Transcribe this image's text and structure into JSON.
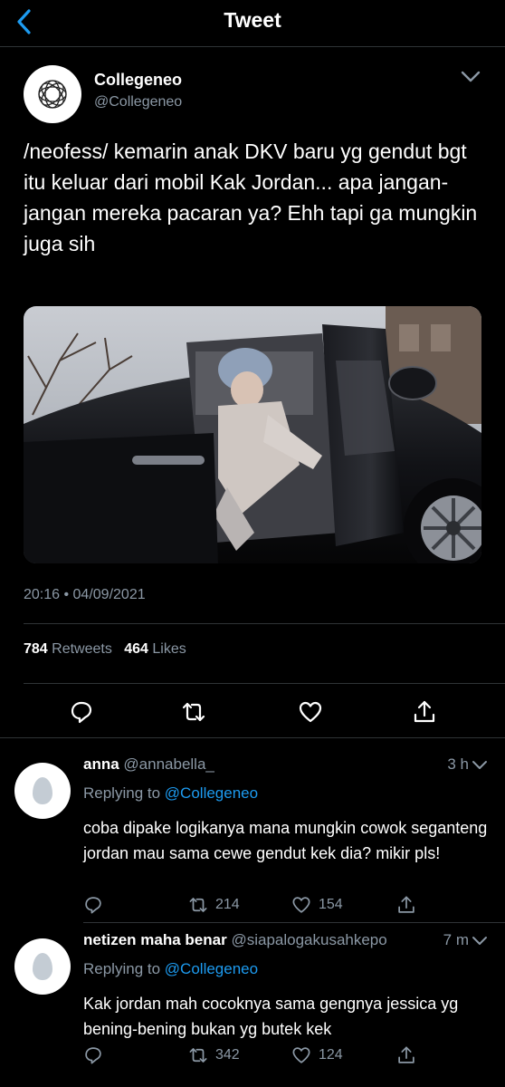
{
  "header": {
    "title": "Tweet"
  },
  "tweet": {
    "author_name": "Collegeneo",
    "author_handle": "@Collegeneo",
    "text": "/neofess/ kemarin anak DKV baru yg gendut bgt  itu keluar dari mobil Kak Jordan... apa jangan-jangan mereka pacaran ya? Ehh tapi ga mungkin juga sih",
    "timestamp": "20:16 • 04/09/2021",
    "retweets_count": "784",
    "retweets_label": "Retweets",
    "likes_count": "464",
    "likes_label": "Likes"
  },
  "replies": [
    {
      "name": "anna",
      "handle": "@annabella_",
      "time": "3 h",
      "replying_label": "Replying to",
      "replying_to": "@Collegeneo",
      "text": "coba dipake logikanya mana mungkin cowok seganteng jordan mau sama cewe gendut kek dia? mikir pls!",
      "retweets": "214",
      "likes": "154"
    },
    {
      "name": "netizen maha benar",
      "handle": "@siapalogakusahkepo",
      "time": "7 m",
      "replying_label": "Replying to",
      "replying_to": "@Collegeneo",
      "text": "Kak jordan mah cocoknya sama gengnya jessica yg bening-bening bukan yg butek kek",
      "retweets": "342",
      "likes": "124"
    }
  ],
  "colors": {
    "accent": "#1d9bf0",
    "background": "#000000",
    "secondary_text": "#8b98a5",
    "divider": "#2f3336"
  },
  "icons": [
    "back-chevron-icon",
    "chevron-down-icon",
    "reply-icon",
    "retweet-icon",
    "like-icon",
    "share-icon"
  ]
}
